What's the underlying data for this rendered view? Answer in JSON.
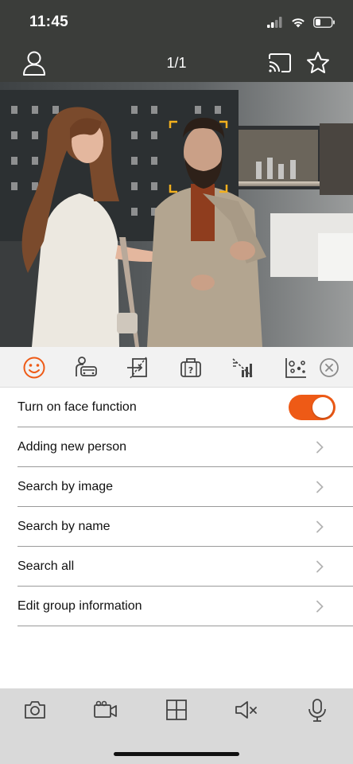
{
  "status_bar": {
    "time": "11:45",
    "icons": [
      "signal-icon",
      "wifi-icon",
      "battery-icon"
    ]
  },
  "nav": {
    "title": "1/1",
    "left_icon": "user-icon",
    "right_icons": [
      "cast-icon",
      "star-icon"
    ]
  },
  "camera": {
    "description_icon": "face-detection-frame"
  },
  "toolbar": {
    "accent": "#ee5a16",
    "icons": [
      "face-icon",
      "vehicle-icon",
      "line-cross-icon",
      "baggage-icon",
      "motion-icon",
      "heatmap-icon",
      "close-icon"
    ]
  },
  "menu": {
    "items": [
      {
        "label": "Turn on face function",
        "type": "toggle",
        "on": true
      },
      {
        "label": "Adding new person",
        "type": "link"
      },
      {
        "label": "Search by image",
        "type": "link"
      },
      {
        "label": "Search by name",
        "type": "link"
      },
      {
        "label": "Search all",
        "type": "link"
      },
      {
        "label": "Edit group information",
        "type": "link"
      }
    ]
  },
  "bottom_bar": {
    "icons": [
      "camera-icon",
      "video-icon",
      "grid-icon",
      "mute-icon",
      "microphone-icon"
    ]
  },
  "colors": {
    "topbar": "#3b3d3a",
    "accent": "#ee5a16",
    "bottombar": "#d9d9d9"
  }
}
